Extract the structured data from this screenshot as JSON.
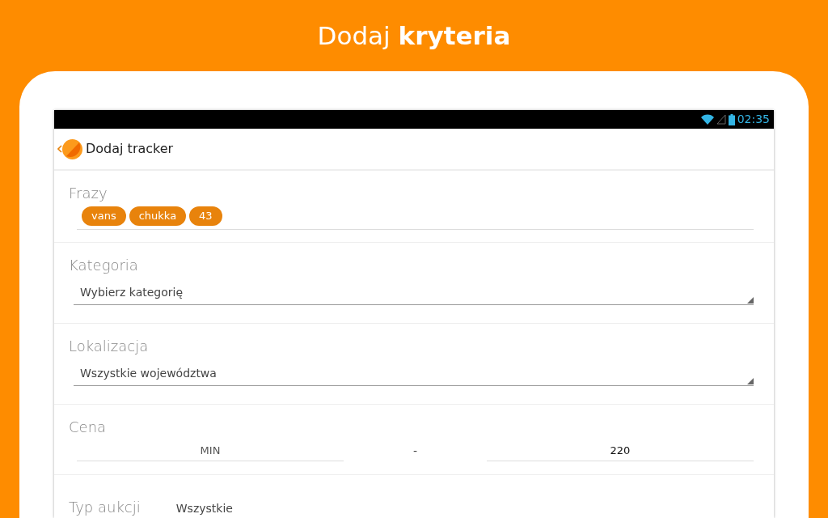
{
  "headline": "Dodaj **kryteria**",
  "status_bar": {
    "time": "02:35"
  },
  "app_bar": {
    "title": "Dodaj tracker"
  },
  "sections": [
    {
      "kind": "tags",
      "label": "Frazy",
      "tags": [
        "vans",
        "chukka",
        "43"
      ]
    },
    {
      "kind": "select",
      "label": "Kategoria",
      "value": "Wybierz kategorię"
    },
    {
      "kind": "select",
      "label": "Lokalizacja",
      "value": "Wszystkie województwa"
    },
    {
      "kind": "range",
      "label": "Cena",
      "min": {
        "placeholder": "MIN"
      },
      "separator": "-",
      "max": {
        "value": "220"
      }
    },
    {
      "kind": "inline",
      "label": "Typ aukcji",
      "value": "Wszystkie"
    }
  ]
}
